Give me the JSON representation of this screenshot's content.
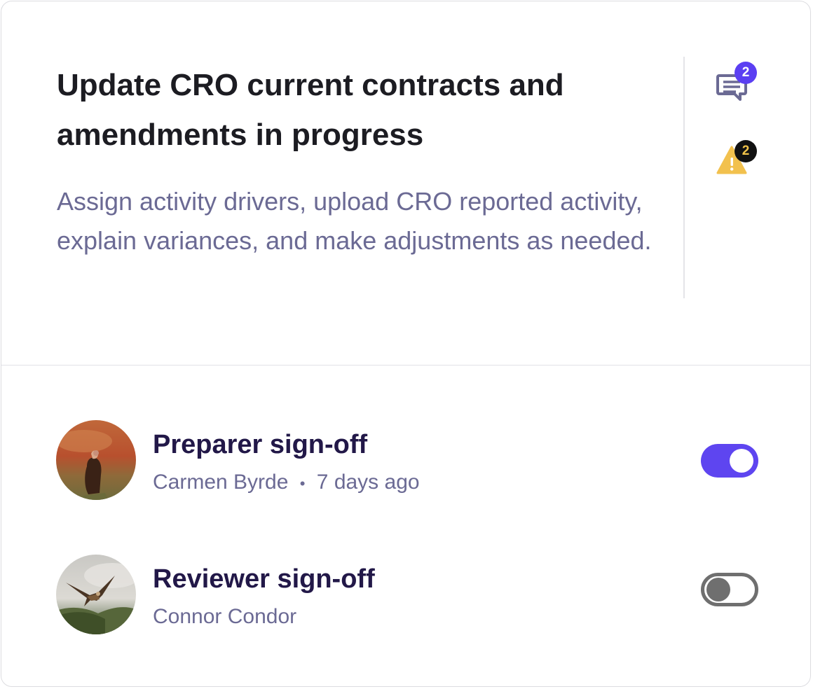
{
  "task": {
    "title": "Update CRO current contracts and amendments in progress",
    "description": "Assign activity drivers, upload CRO reported activity, explain variances, and make adjustments as needed."
  },
  "indicators": {
    "comments": {
      "icon": "comment-icon",
      "count": "2",
      "color": "#5b3ff2"
    },
    "warnings": {
      "icon": "warning-icon",
      "count": "2",
      "color": "#f2c14e"
    }
  },
  "signoffs": [
    {
      "title": "Preparer sign-off",
      "name": "Carmen Byrde",
      "separator": "•",
      "time": "7 days ago",
      "signed": true,
      "avatar": "vulture-avatar"
    },
    {
      "title": "Reviewer sign-off",
      "name": "Connor Condor",
      "signed": false,
      "avatar": "condor-avatar"
    }
  ],
  "colors": {
    "accent": "#5e45f0",
    "title": "#1c1c22",
    "muted": "#6b6a94",
    "toggle_off": "#6f6f6f"
  }
}
